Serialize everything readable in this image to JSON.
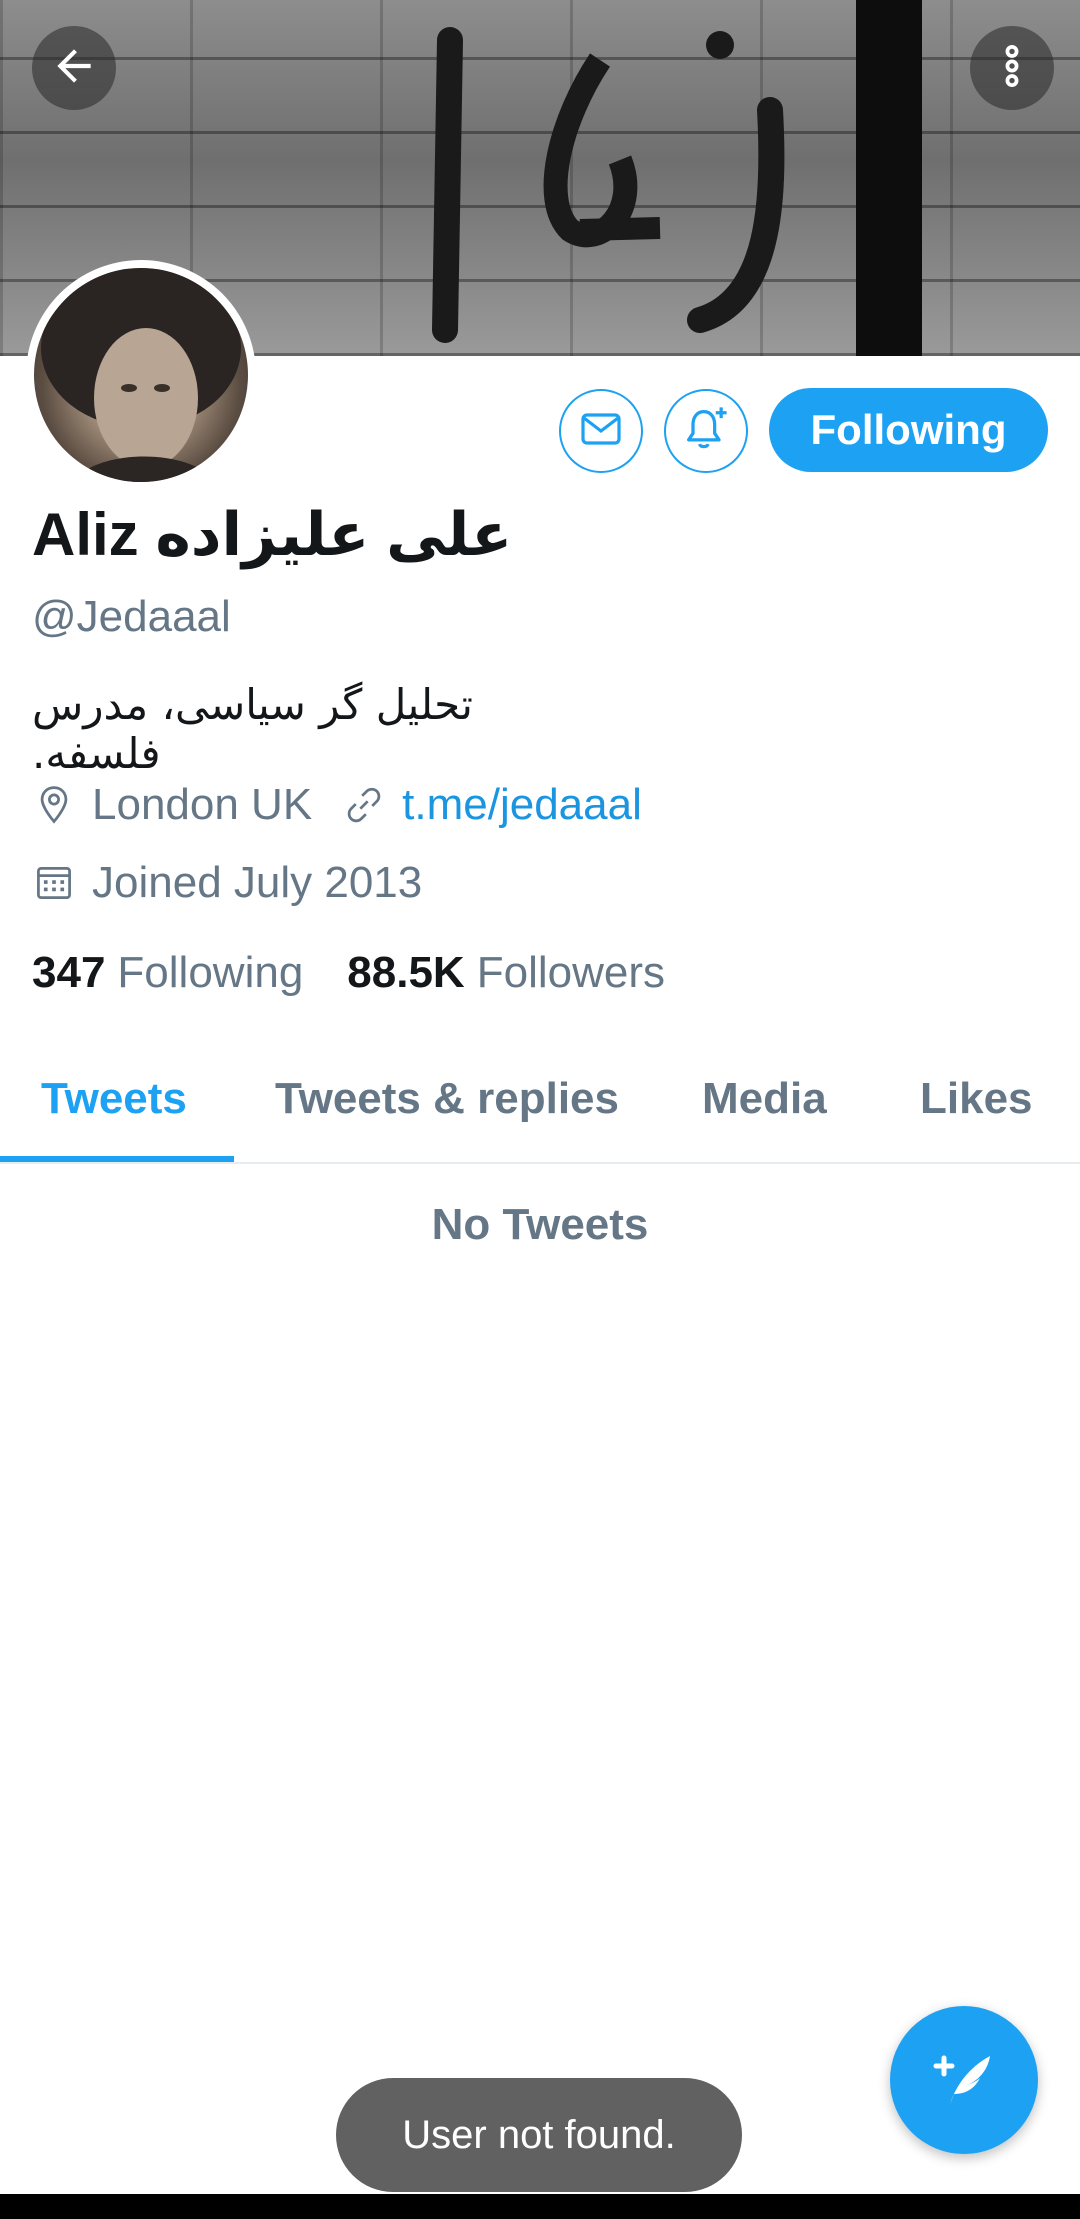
{
  "header": {
    "back_icon": "arrow-left-icon",
    "more_icon": "more-vertical-icon"
  },
  "profile": {
    "display_name": "Aliz علی علیزاده",
    "handle": "@Jedaaal",
    "bio": "تحلیل گر سیاسی، مدرس فلسفه.",
    "location": "London UK",
    "website": "t.me/jedaaal",
    "joined": "Joined July 2013",
    "following_count": "347",
    "following_label": "Following",
    "followers_count": "88.5K",
    "followers_label": "Followers"
  },
  "actions": {
    "message_icon": "mail-icon",
    "notify_icon": "bell-plus-icon",
    "follow_state_label": "Following"
  },
  "tabs": [
    {
      "label": "Tweets",
      "active": true
    },
    {
      "label": "Tweets & replies",
      "active": false
    },
    {
      "label": "Media",
      "active": false
    },
    {
      "label": "Likes",
      "active": false
    }
  ],
  "content": {
    "empty_message": "No Tweets"
  },
  "compose": {
    "icon": "compose-tweet-icon"
  },
  "toast": {
    "message": "User not found."
  },
  "colors": {
    "accent": "#1da1f2",
    "secondary_text": "#657786",
    "primary_text": "#14171a"
  }
}
